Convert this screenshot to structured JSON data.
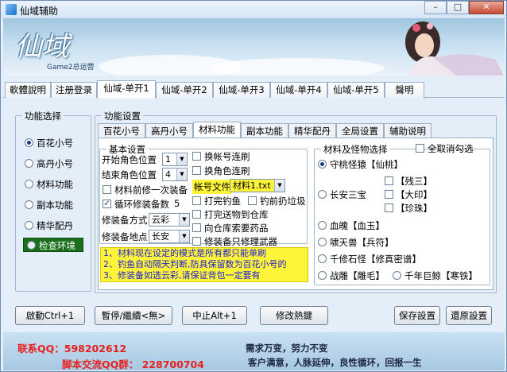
{
  "window": {
    "title": "仙域辅助",
    "min": "–",
    "max": "□",
    "close": "✕"
  },
  "banner": {
    "logo": "仙域",
    "subtitle": "Game2总运营"
  },
  "tabs": [
    "軟體說明",
    "注册登录",
    "仙域-单开1",
    "仙域-单开2",
    "仙域-单开3",
    "仙域-单开4",
    "仙域-单开5",
    "聲明"
  ],
  "left_group": {
    "title": "功能选择",
    "items": [
      "百花小号",
      "高丹小号",
      "材料功能",
      "副本功能",
      "精华配丹"
    ],
    "selected": 0,
    "status_label": "检查环境"
  },
  "settings": {
    "title": "功能设置",
    "tabs": [
      "百花小号",
      "高丹小号",
      "材料功能",
      "副本功能",
      "精华配丹",
      "全局设置",
      "辅助说明"
    ],
    "active_tab": 2
  },
  "basic": {
    "title": "基本设置",
    "start_pos_label": "开始角色位置",
    "start_pos_value": "1",
    "end_pos_label": "结束角色位置",
    "end_pos_value": "4",
    "material_first": "材料前修一次装备",
    "cycle_repair_label": "循环修装备数",
    "cycle_repair_value": "5",
    "repair_mode_label": "修装备方式",
    "repair_mode_value": "云彩",
    "repair_place_label": "修装备地点",
    "repair_place_value": "长安",
    "switch_account": "换帐号连刷",
    "switch_char": "换角色连刷",
    "account_file_label": "帐号文件",
    "account_file_value": "材料1.txt",
    "fish_done": "打完钓鱼",
    "fish_discard": "钓前扔垃圾",
    "send_to_storage": "打完送物到仓库",
    "request_potion": "向仓库索要药品",
    "backup_repair": "修装备只修理武器"
  },
  "notes": [
    "1、材料现在设定的模式是所有都只能单刷",
    "2、钓鱼自动隔天判断,防具保留数为百花小号的",
    "3、修装备如选云彩,请保证背包一定要有"
  ],
  "material": {
    "title": "材料及怪物选择",
    "select_all": "全取消勾选",
    "options": [
      "守桃怪猿【仙桃】",
      "长安三宝",
      "血魄【血玉】",
      "啸天兽【兵符】",
      "千修石怪【修真密谱】",
      "战雕【雕毛】",
      "千年巨鲸【寒铁】"
    ],
    "selected": 0,
    "sub_items": [
      "【残三】",
      "【大印】",
      "【珍珠】"
    ]
  },
  "buttons": {
    "start": "啟動Ctrl+1",
    "pause": "暫停/繼續<無>",
    "stop": "中止Alt+1",
    "modify_hotkey": "修改熱鍵",
    "save": "保存設置",
    "restore": "還原設置"
  },
  "footer": {
    "qq_contact": "联系QQ：598202612",
    "qq_group": "脚本交流QQ群： 228700704",
    "slogan1": "需求万变，努力不变",
    "slogan2": "客户满意，人脉延伸，良性循环，回报一生"
  },
  "colors": {
    "accent": "#183a8a",
    "footer_red": "#e8201e",
    "notes_bg": "#fef43a",
    "status_bg": "#1a6f1a"
  }
}
